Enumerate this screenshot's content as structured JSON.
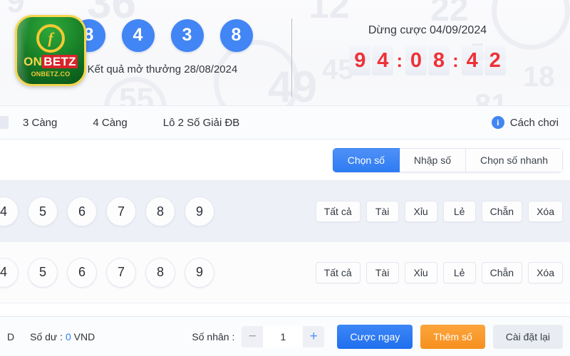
{
  "banner": {
    "balls": [
      "8",
      "4",
      "3",
      "8"
    ],
    "result_label": "Kết quả mở thưởng 28/08/2024",
    "stop_label": "Dừng cược 04/09/2024",
    "countdown": {
      "digits": [
        "9",
        "4",
        "0",
        "8",
        "4",
        "2"
      ],
      "separator": ":",
      "full": "94:08:42"
    },
    "logo": {
      "mark": "f",
      "name_part1": "ON",
      "name_part2": "BETZ",
      "subtitle": "ONBETZ.CO"
    },
    "watermarks": [
      "12",
      "49",
      "55",
      "22",
      "18",
      "45",
      "5",
      "9",
      "81",
      "36"
    ],
    "colors": {
      "ball": "#4285f4",
      "countdown_digit": "#ed3237"
    }
  },
  "tabs": {
    "items": [
      {
        "label": "3 Càng"
      },
      {
        "label": "4 Càng"
      },
      {
        "label": "Lô 2 Số Giải ĐB"
      }
    ],
    "howto_label": "Cách chơi",
    "info_icon": "info-icon"
  },
  "modes": {
    "items": [
      {
        "label": "Chọn số",
        "active": true
      },
      {
        "label": "Nhập số",
        "active": false
      },
      {
        "label": "Chọn số nhanh",
        "active": false
      }
    ],
    "active_color": "#2f7cf3"
  },
  "number_rows": [
    {
      "digits": [
        "4",
        "5",
        "6",
        "7",
        "8",
        "9"
      ],
      "options": [
        "Tất cả",
        "Tài",
        "Xỉu",
        "Lẻ",
        "Chẵn",
        "Xóa"
      ]
    },
    {
      "digits": [
        "4",
        "5",
        "6",
        "7",
        "8",
        "9"
      ],
      "options": [
        "Tất cả",
        "Tài",
        "Xỉu",
        "Lẻ",
        "Chẵn",
        "Xóa"
      ]
    }
  ],
  "footer": {
    "cut_text": "D",
    "balance_prefix": "Số dư : ",
    "balance_value": "0",
    "balance_currency": " VND",
    "multiplier_label": "Số nhân :",
    "multiplier_value": "1",
    "minus_icon": "minus-icon",
    "plus_icon": "plus-icon",
    "buttons": [
      {
        "label": "Cược ngay",
        "style": "primary"
      },
      {
        "label": "Thêm số",
        "style": "warn"
      },
      {
        "label": "Cài đặt lại",
        "style": "muted"
      }
    ]
  }
}
